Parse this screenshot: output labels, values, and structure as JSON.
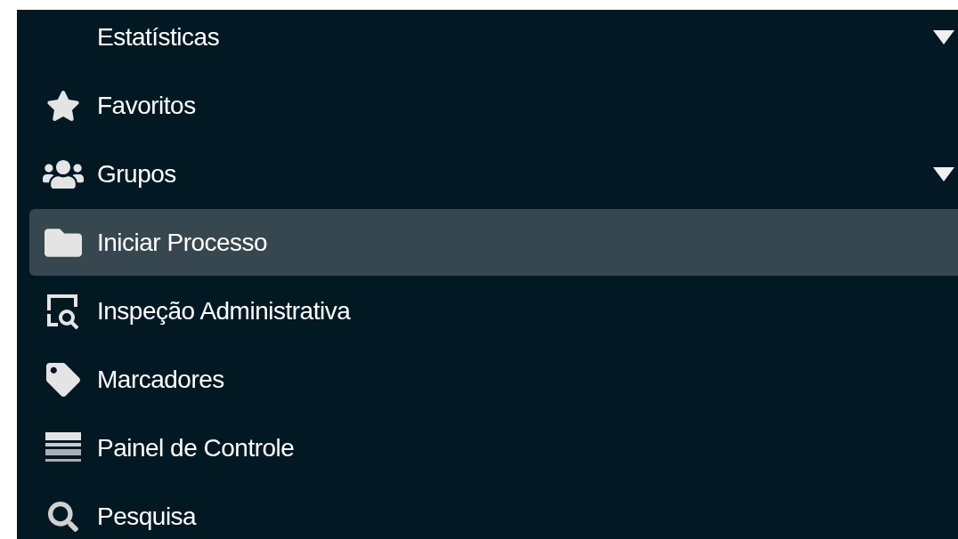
{
  "menu": {
    "items": [
      {
        "label": "Estatísticas",
        "selected": false,
        "has_submenu": true
      },
      {
        "label": "Favoritos",
        "selected": false,
        "has_submenu": false
      },
      {
        "label": "Grupos",
        "selected": false,
        "has_submenu": true
      },
      {
        "label": "Iniciar Processo",
        "selected": true,
        "has_submenu": false
      },
      {
        "label": "Inspeção Administrativa",
        "selected": false,
        "has_submenu": false
      },
      {
        "label": "Marcadores",
        "selected": false,
        "has_submenu": false
      },
      {
        "label": "Painel de Controle",
        "selected": false,
        "has_submenu": false
      },
      {
        "label": "Pesquisa",
        "selected": false,
        "has_submenu": false
      }
    ]
  }
}
